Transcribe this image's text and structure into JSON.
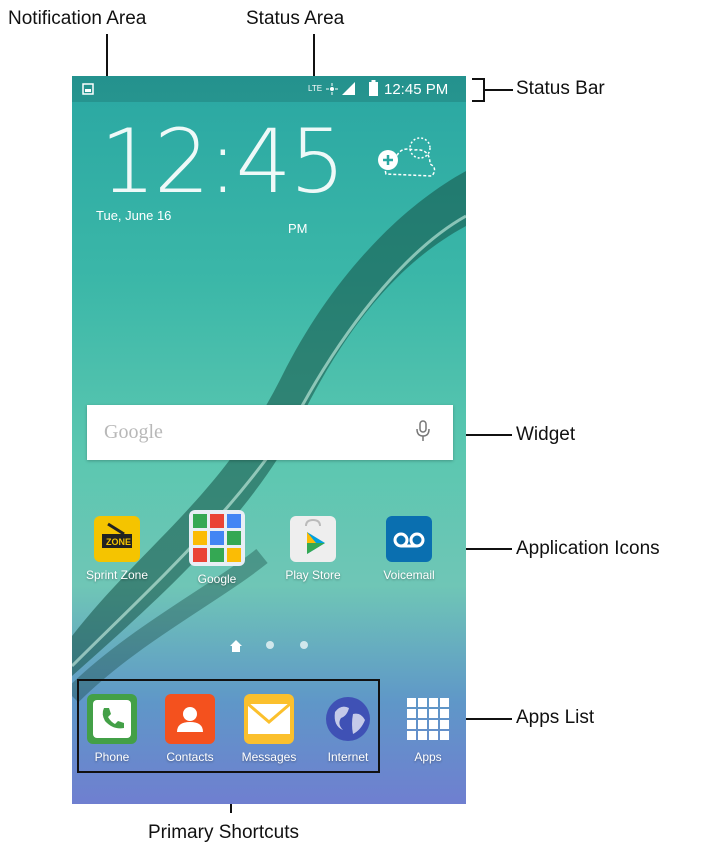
{
  "annotations": {
    "notification_area": "Notification Area",
    "status_area": "Status Area",
    "status_bar": "Status Bar",
    "widget": "Widget",
    "application_icons": "Application Icons",
    "apps_list": "Apps List",
    "primary_shortcuts": "Primary Shortcuts"
  },
  "statusbar": {
    "network": "LTE",
    "time": "12:45 PM",
    "icons": [
      "notification-image-icon",
      "data-activity-icon",
      "signal-icon",
      "battery-icon"
    ]
  },
  "clock": {
    "time": "12:45",
    "ampm": "PM",
    "date": "Tue, June 16"
  },
  "search": {
    "placeholder": "Google",
    "icon": "mic-icon"
  },
  "apps": [
    {
      "label": "Sprint Zone",
      "icon": "sprint-zone-icon",
      "color": "#f5c400"
    },
    {
      "label": "Google",
      "icon": "google-folder-icon",
      "color": "#e8eef5"
    },
    {
      "label": "Play Store",
      "icon": "play-store-icon",
      "color": "#eeeeee"
    },
    {
      "label": "Voicemail",
      "icon": "voicemail-icon",
      "color": "#0a6fb0"
    }
  ],
  "dock": [
    {
      "label": "Phone",
      "icon": "phone-icon",
      "color": "#43a047"
    },
    {
      "label": "Contacts",
      "icon": "contacts-icon",
      "color": "#f4511e"
    },
    {
      "label": "Messages",
      "icon": "messages-icon",
      "color": "#fbc02d"
    },
    {
      "label": "Internet",
      "icon": "internet-globe-icon",
      "color": "#3f51b5"
    },
    {
      "label": "Apps",
      "icon": "apps-grid-icon",
      "color": "#ffffff"
    }
  ]
}
